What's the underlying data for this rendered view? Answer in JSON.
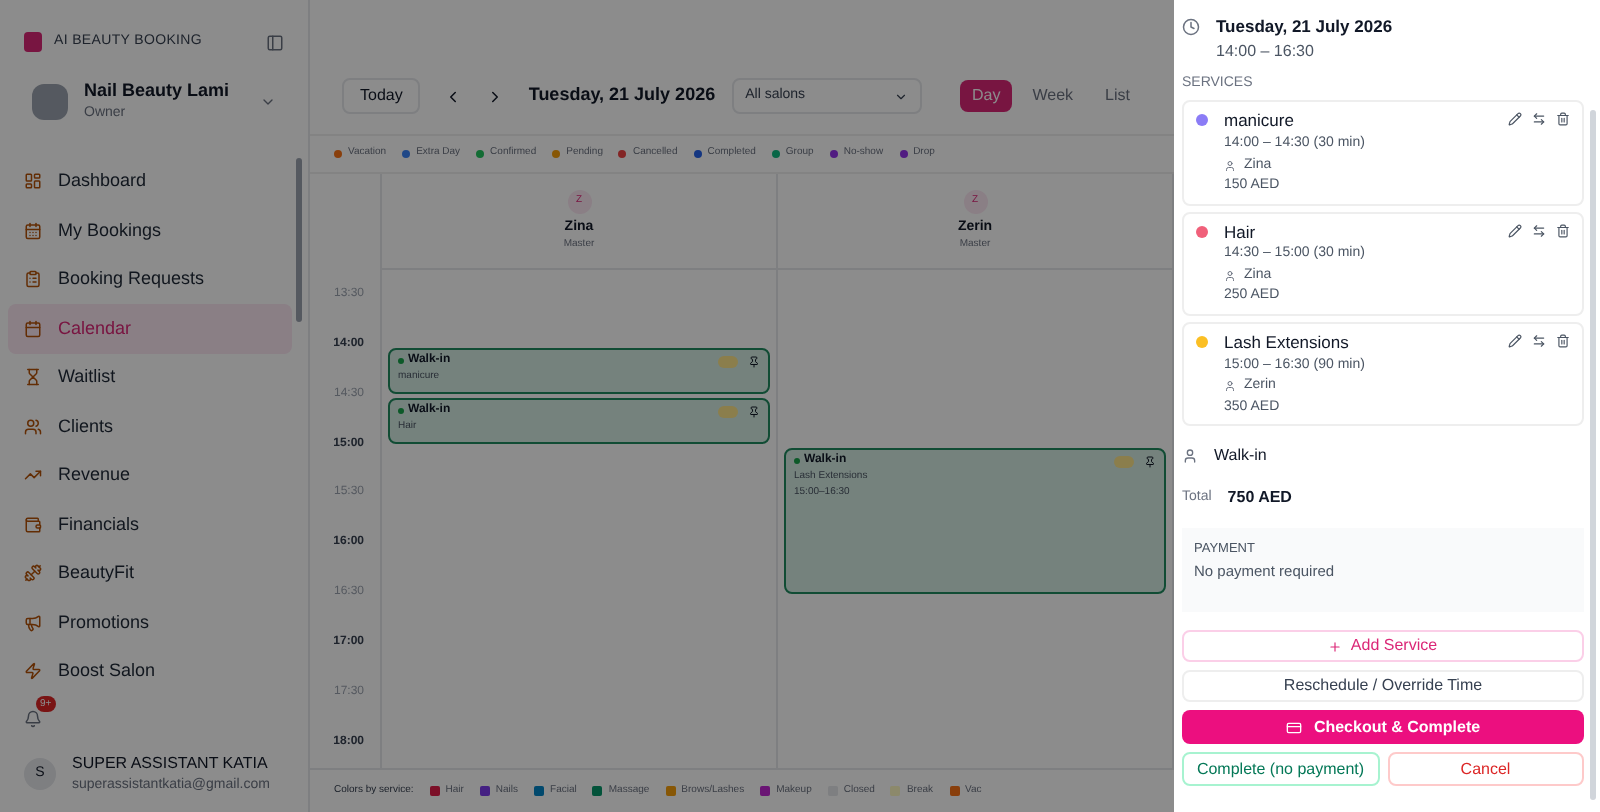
{
  "sidebar": {
    "brand": "AI BEAUTY BOOKING",
    "account": {
      "name": "Nail Beauty Lami",
      "role": "Owner"
    },
    "nav": [
      {
        "label": "Dashboard",
        "selected": false
      },
      {
        "label": "My Bookings",
        "selected": false
      },
      {
        "label": "Booking Requests",
        "selected": false
      },
      {
        "label": "Calendar",
        "selected": true
      },
      {
        "label": "Waitlist",
        "selected": false
      },
      {
        "label": "Clients",
        "selected": false
      },
      {
        "label": "Revenue",
        "selected": false
      },
      {
        "label": "Financials",
        "selected": false
      },
      {
        "label": "BeautyFit",
        "selected": false
      },
      {
        "label": "Promotions",
        "selected": false
      },
      {
        "label": "Boost Salon",
        "selected": false
      }
    ],
    "notification_badge": "9+",
    "user": {
      "initial": "S",
      "name": "SUPER ASSISTANT KATIA",
      "email": "superassistantkatia@gmail.com"
    }
  },
  "toolbar": {
    "today": "Today",
    "date": "Tuesday, 21 July 2026",
    "salon_select": "All salons",
    "views": [
      {
        "label": "Day",
        "selected": true
      },
      {
        "label": "Week",
        "selected": false
      },
      {
        "label": "List",
        "selected": false
      }
    ]
  },
  "status_legend": [
    {
      "label": "Vacation",
      "color": "#893f0c"
    },
    {
      "label": "Extra Day",
      "color": "#204887"
    },
    {
      "label": "Confirmed",
      "color": "#136c34"
    },
    {
      "label": "Pending",
      "color": "#875706"
    },
    {
      "label": "Cancelled",
      "color": "#832525"
    },
    {
      "label": "Completed",
      "color": "#143681"
    },
    {
      "label": "Group",
      "color": "#096647"
    },
    {
      "label": "No-show",
      "color": "#511c81"
    },
    {
      "label": "Drop",
      "color": "#511c81"
    }
  ],
  "staff": [
    {
      "initial": "Z",
      "name": "Zina",
      "role": "Master",
      "slots": [
        {
          "kind": "free"
        },
        {
          "kind": "start",
          "title": "Walk-in",
          "service": "manicure"
        },
        {
          "kind": "start",
          "title": "Walk-in",
          "service": "Hair"
        },
        {
          "kind": "free"
        },
        {
          "kind": "free"
        },
        {
          "kind": "free"
        },
        {
          "kind": "free"
        },
        {
          "kind": "free"
        },
        {
          "kind": "free"
        }
      ]
    },
    {
      "initial": "Z",
      "name": "Zerin",
      "role": "Master",
      "slots": [
        {
          "kind": "free"
        },
        {
          "kind": "free"
        },
        {
          "kind": "free"
        },
        {
          "kind": "start",
          "title": "Walk-in",
          "service": "Lash Extensions",
          "time": "15:00–16:30"
        },
        {
          "kind": "continue"
        },
        {
          "kind": "continue"
        },
        {
          "kind": "free"
        },
        {
          "kind": "free"
        },
        {
          "kind": "free"
        }
      ]
    }
  ],
  "time_slots": [
    {
      "label": "13:30",
      "hour": false
    },
    {
      "label": "14:00",
      "hour": true
    },
    {
      "label": "14:30",
      "hour": false
    },
    {
      "label": "15:00",
      "hour": true
    },
    {
      "label": "15:30",
      "hour": false
    },
    {
      "label": "16:00",
      "hour": true
    },
    {
      "label": "16:30",
      "hour": false
    },
    {
      "label": "17:00",
      "hour": true
    },
    {
      "label": "17:30",
      "hour": false
    },
    {
      "label": "18:00",
      "hour": true
    }
  ],
  "service_legend": {
    "title": "Colors by service:",
    "items": [
      {
        "label": "Hair",
        "color": "#7c1028"
      },
      {
        "label": "Nails",
        "color": "#442082"
      },
      {
        "label": "Facial",
        "color": "#01496d"
      },
      {
        "label": "Massage",
        "color": "#03533a"
      },
      {
        "label": "Brows/Lashes",
        "color": "#875706"
      },
      {
        "label": "Makeup",
        "color": "#6a1574"
      },
      {
        "label": "Closed",
        "color": "#7e7f81"
      },
      {
        "label": "Break",
        "color": "#8c896b"
      },
      {
        "label": "Vac",
        "color": "#893f0c"
      }
    ]
  },
  "drawer": {
    "date": "Tuesday, 21 July 2026",
    "time": "14:00 – 16:30",
    "services_title": "SERVICES",
    "services": [
      {
        "name": "manicure",
        "color": "#8b7cf6",
        "time": "14:00 – 14:30 (30 min)",
        "staff": "Zina",
        "price": "150 AED"
      },
      {
        "name": "Hair",
        "color": "#f0607a",
        "time": "14:30 – 15:00 (30 min)",
        "staff": "Zina",
        "price": "250 AED"
      },
      {
        "name": "Lash Extensions",
        "color": "#fbbf24",
        "time": "15:00 – 16:30 (90 min)",
        "staff": "Zerin",
        "price": "350 AED"
      }
    ],
    "client": "Walk-in",
    "total_label": "Total",
    "total": "750 AED",
    "payment": {
      "title": "PAYMENT",
      "text": "No payment required"
    },
    "add_service": "Add Service",
    "reschedule": "Reschedule / Override Time",
    "checkout": "Checkout & Complete",
    "complete": "Complete (no payment)",
    "cancel": "Cancel"
  }
}
